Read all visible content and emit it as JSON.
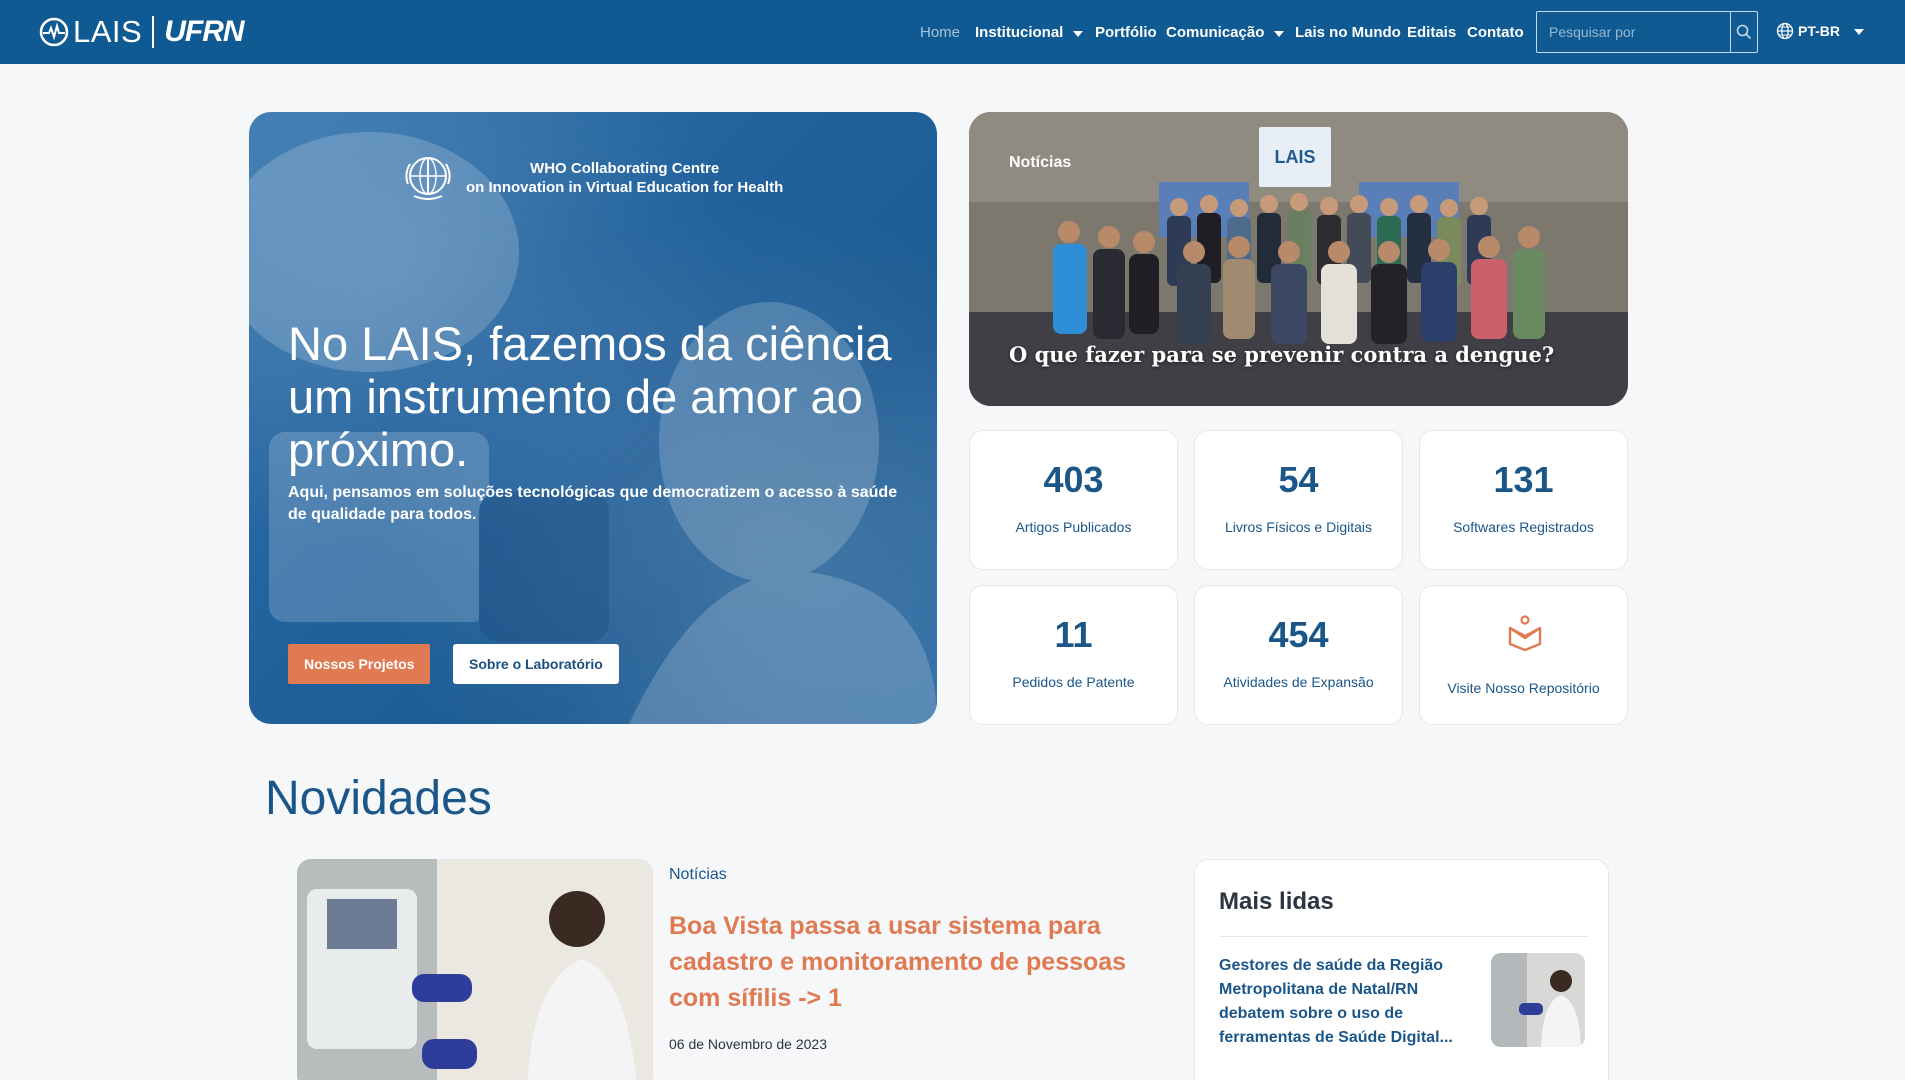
{
  "header": {
    "logo_lais": "LAIS",
    "logo_ufrn": "UFRN",
    "nav": [
      {
        "label": "Home",
        "active": true,
        "dropdown": false
      },
      {
        "label": "Institucional",
        "active": false,
        "dropdown": true
      },
      {
        "label": "Portfólio",
        "active": false,
        "dropdown": false
      },
      {
        "label": "Comunicação",
        "active": false,
        "dropdown": true
      },
      {
        "label": "Lais no Mundo",
        "active": false,
        "dropdown": false
      },
      {
        "label": "Editais",
        "active": false,
        "dropdown": false
      },
      {
        "label": "Contato",
        "active": false,
        "dropdown": false
      }
    ],
    "search_placeholder": "Pesquisar por",
    "search_value": "",
    "language": "PT-BR"
  },
  "hero": {
    "who_line1": "WHO Collaborating Centre",
    "who_line2": "on Innovation in Virtual Education for Health",
    "title": "No LAIS, fazemos da ciência um instrumento de amor ao próximo.",
    "subtitle": "Aqui, pensamos em soluções tecnológicas que democratizem o acesso à saúde de qualidade para todos.",
    "primary_button": "Nossos Projetos",
    "secondary_button": "Sobre o Laboratório"
  },
  "news_card": {
    "tag": "Notícias",
    "banner": "LAIS",
    "headline": "O que fazer para se prevenir contra a dengue?"
  },
  "stats": [
    {
      "value": "403",
      "label": "Artigos Publicados"
    },
    {
      "value": "54",
      "label": "Livros Físicos e Digitais"
    },
    {
      "value": "131",
      "label": "Softwares Registrados"
    },
    {
      "value": "11",
      "label": "Pedidos de Patente"
    },
    {
      "value": "454",
      "label": "Atividades de Expansão"
    },
    {
      "value": "",
      "label": "Visite Nosso Repositório",
      "icon": "repository-icon"
    }
  ],
  "novidades": {
    "title": "Novidades",
    "article": {
      "tag": "Notícias",
      "title": "Boa Vista passa a usar sistema para cadastro e monitoramento de pessoas com sífilis -> 1",
      "date": "06 de Novembro de 2023"
    },
    "mais_lidas": {
      "title": "Mais lidas",
      "items": [
        {
          "title": "Gestores de saúde da Região Metropolitana de Natal/RN debatem sobre o uso de ferramentas de Saúde Digital..."
        }
      ]
    }
  },
  "colors": {
    "header_bg": "#0f5a92",
    "accent_orange": "#e07a52",
    "primary_blue": "#1b5689",
    "page_bg": "#f6f7f9"
  }
}
